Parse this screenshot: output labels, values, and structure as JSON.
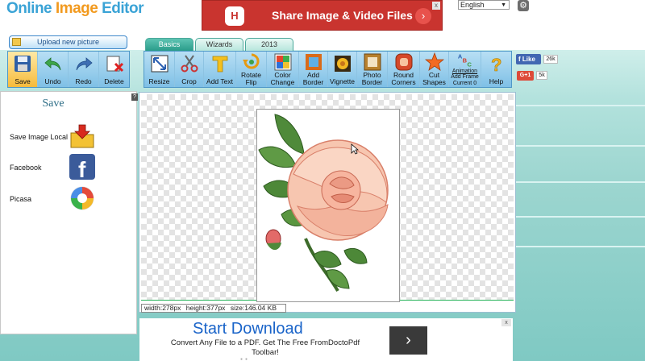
{
  "app": {
    "title_main": "Online ",
    "title_accent": "Image",
    "title_end": " Editor"
  },
  "top_ad": {
    "text": "Share Image & Video Files",
    "logo": "H",
    "go_glyph": "›",
    "close_glyph": "x",
    "color": "#c9342f"
  },
  "language": {
    "selected": "English",
    "caret": "▼"
  },
  "settings_icon": "gear-icon",
  "upload": {
    "label": "Upload new picture"
  },
  "tabs": [
    {
      "label": "Basics",
      "active": true
    },
    {
      "label": "Wizards",
      "active": false
    },
    {
      "label": "2013",
      "active": false
    }
  ],
  "toolbar_left": [
    {
      "label": "Save",
      "icon": "floppy-disk-icon"
    },
    {
      "label": "Undo",
      "icon": "undo-arrow-icon"
    },
    {
      "label": "Redo",
      "icon": "redo-arrow-icon"
    },
    {
      "label": "Delete",
      "icon": "delete-icon"
    }
  ],
  "toolbar_main": [
    {
      "label": "Resize",
      "icon": "resize-icon"
    },
    {
      "label": "Crop",
      "icon": "scissors-icon"
    },
    {
      "label": "Add Text",
      "icon": "text-icon"
    },
    {
      "label": "Rotate Flip",
      "line1": "Rotate",
      "line2": "Flip",
      "icon": "rotate-icon"
    },
    {
      "label": "Color Change",
      "line1": "Color",
      "line2": "Change",
      "icon": "color-change-icon"
    },
    {
      "label": "Add Border",
      "line1": "Add",
      "line2": "Border",
      "icon": "border-icon"
    },
    {
      "label": "Vignette",
      "icon": "vignette-icon"
    },
    {
      "label": "Photo Border",
      "line1": "Photo",
      "line2": "Border",
      "icon": "photo-border-icon"
    },
    {
      "label": "Round Corners",
      "line1": "Round",
      "line2": "Corners",
      "icon": "round-corners-icon"
    },
    {
      "label": "Cut Shapes",
      "line1": "Cut",
      "line2": "Shapes",
      "icon": "star-shape-icon"
    },
    {
      "label": "Animation",
      "line1": "Animation",
      "line2": "Add Frame",
      "line3": "Current 0",
      "icon": "abc-animation-icon"
    },
    {
      "label": "Help",
      "icon": "help-icon"
    }
  ],
  "social": {
    "fb_label": "Like",
    "fb_count": "26k",
    "gp_label": "G+1",
    "gp_count": "5k"
  },
  "side_panel": {
    "title": "Save",
    "help": "?",
    "items": [
      {
        "label": "Save Image Local",
        "icon": "save-local-icon"
      },
      {
        "label": "Facebook",
        "icon": "facebook-icon"
      },
      {
        "label": "Picasa",
        "icon": "picasa-icon"
      }
    ]
  },
  "canvas": {
    "status": {
      "width": "width:278px",
      "height": "height:377px",
      "size": "size:146.04 KB"
    }
  },
  "bottom_ad": {
    "title": "Start Download",
    "text": "Convert Any File to a PDF. Get The Free FromDoctoPdf Toolbar!",
    "go_glyph": "›",
    "close_glyph": "x"
  }
}
